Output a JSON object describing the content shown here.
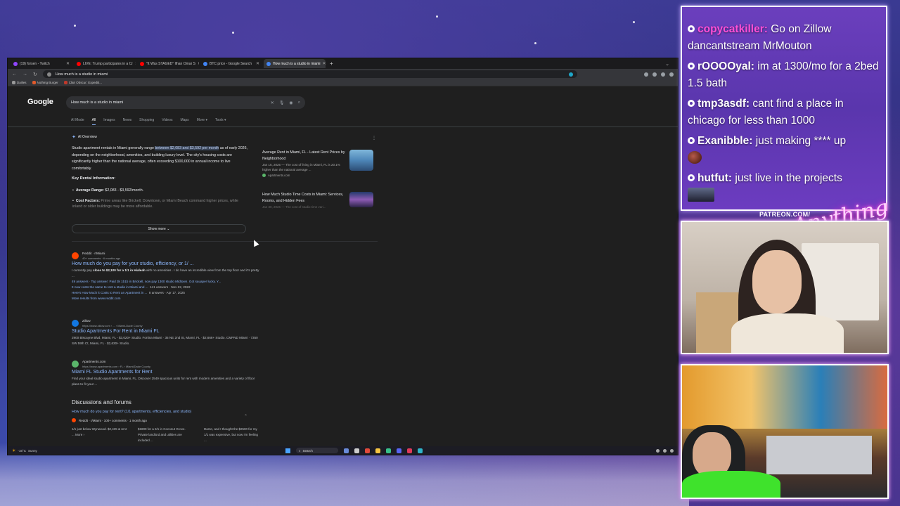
{
  "browser": {
    "tabs": [
      {
        "label": "(19) forsen - Twitch",
        "color": "#9146ff",
        "active": false
      },
      {
        "label": "LIVE: Trump participates in a Cr",
        "color": "#ff0000",
        "active": false
      },
      {
        "label": "\"It Was STAGED\" Ilhan Omar S",
        "color": "#ff0000",
        "active": false
      },
      {
        "label": "BTC price - Google Search",
        "color": "#4285f4",
        "active": false
      },
      {
        "label": "How much is a studio in miami",
        "color": "#4285f4",
        "active": true
      }
    ],
    "address": "How much is a studio in miami",
    "bookmarks": [
      {
        "label": "Dailies",
        "color": "#999999"
      },
      {
        "label": "Nothing Burger",
        "color": "#e05a2b"
      },
      {
        "label": "Clair Obscur: Expediti...",
        "color": "#c0392b"
      }
    ]
  },
  "google": {
    "logo": "Google",
    "query": "How much is a studio in miami",
    "tabs": [
      "AI Mode",
      "All",
      "Images",
      "News",
      "Shopping",
      "Videos",
      "Maps",
      "More ▾",
      "Tools ▾"
    ],
    "active_tab": "All",
    "ai_overview": {
      "label": "AI Overview",
      "intro_pre": "Studio apartment rentals in Miami generally range ",
      "intro_hl": "between $2,083 and $3,592 per month",
      "intro_post": " as of early 2026, depending on the neighborhood, amenities, and building luxury level. The city's housing costs are significantly higher than the national average, often exceeding $100,000 in annual income to live comfortably.",
      "subheading": "Key Rental Information:",
      "bullet1_label": "Average Range:",
      "bullet1_text": " $2,083 - $3,592/month.",
      "bullet2_label": "Cost Factors:",
      "bullet2_text": " Prime areas like Brickell, Downtown, or Miami Beach command higher prices, while inland or older buildings may be more affordable.",
      "show_more": "Show more",
      "sources": [
        {
          "title": "Average Rent in Miami, FL - Latest Rent Prices by Neighborhood",
          "snippet": "Jan 15, 2026 — The cost of living in Miami, FL is 20.1% higher than the national average ...",
          "site": "Apartments.com"
        },
        {
          "title": "How Much Studio Time Costs in Miami: Services, Rooms, and Hidden Fees",
          "snippet": "Jan 30, 2026 — The cost of studio time vari...",
          "site": ""
        }
      ]
    },
    "results": [
      {
        "site": "Reddit · r/Miami",
        "meta": "40+ comments · 6 months ago",
        "title": "How much do you pay for your studio, efficiency, or 1/ ...",
        "snippet_pre": "I currently pay ",
        "snippet_b": "close to $2,100 for a 1/1 in Hialeah",
        "snippet_post": " with no amenities . I do have an incredible view from the top floor and it's pretty ...",
        "line2": "49 answers · Top answer: Paid 3k 1b1b in Brickell, now pay 1300 studio Midtown. Got sauaper lucky. Y...",
        "sub1": "It now costs the same to rent a studio in Miami and ...",
        "sub1_meta": "141 answers · Nov 22, 2022",
        "sub2": "Here's How Much it Costs to Rent an Apartment in ...",
        "sub2_meta": "8 answers · Apr 17, 2025",
        "more": "More results from www.reddit.com"
      },
      {
        "site": "Zillow",
        "meta": "https://www.zillow.com › ... › Miami-Dade County",
        "title": "Studio Apartments For Rent in Miami FL",
        "snippet": "2900 Biscayne Blvd, Miami, FL - $3,020+ Studio. Fortina Miami · 35 NE 2nd St, Miami, FL · $2,668+ Studio. CMPND Miami · 7350 SW 59th Ct, Miami, FL · $2,630+ Studio."
      },
      {
        "site": "Apartments.com",
        "meta": "https://www.apartments.com › FL › Miami/Dade County",
        "title": "Miami FL Studio Apartments for Rent",
        "snippet": "Find your ideal studio apartment in Miami, FL. Discover 2549 spacious units for rent with modern amenities and a variety of floor plans to fit your ..."
      }
    ],
    "discussions": {
      "heading": "Discussions and forums",
      "question": "How much do you pay for rent? (1/1 apartments, efficiencies, and studio)",
      "source": "Reddit · r/Miami · 100+ comments · 1 month ago",
      "cols": [
        "1/1 just below Wynwood. $2,435 & rent ... More ›",
        "$1800 for a 2/1 in Coconut Grove. Private landlord and utilities are included ...",
        "Damn, and I thought the $2500 for my 1/1 was expensive, but now I'm feeling ..."
      ]
    }
  },
  "taskbar": {
    "weather_temp": "-15°C",
    "weather_desc": "Sunny",
    "search": "Search"
  },
  "chat": {
    "cut_top": "....",
    "messages": [
      {
        "user": "copycatkiller:",
        "color": "#ff4fd8",
        "text": " Go on Zillow dancantstream MrMouton"
      },
      {
        "user": "rOOOOyal:",
        "color": "#ffffff",
        "text": " im at 1300/mo for a 2bed 1.5 bath"
      },
      {
        "user": "tmp3asdf:",
        "color": "#ffffff",
        "text": " cant find a place in chicago for less than 1000"
      },
      {
        "user": "Exanibble:",
        "color": "#ffffff",
        "text": " just making **** up"
      },
      {
        "user": "hutfut:",
        "color": "#ffffff",
        "text": " just live in the projects"
      }
    ]
  },
  "overlay": {
    "patreon": "PATREON.COM/",
    "neon": "Anything else"
  }
}
